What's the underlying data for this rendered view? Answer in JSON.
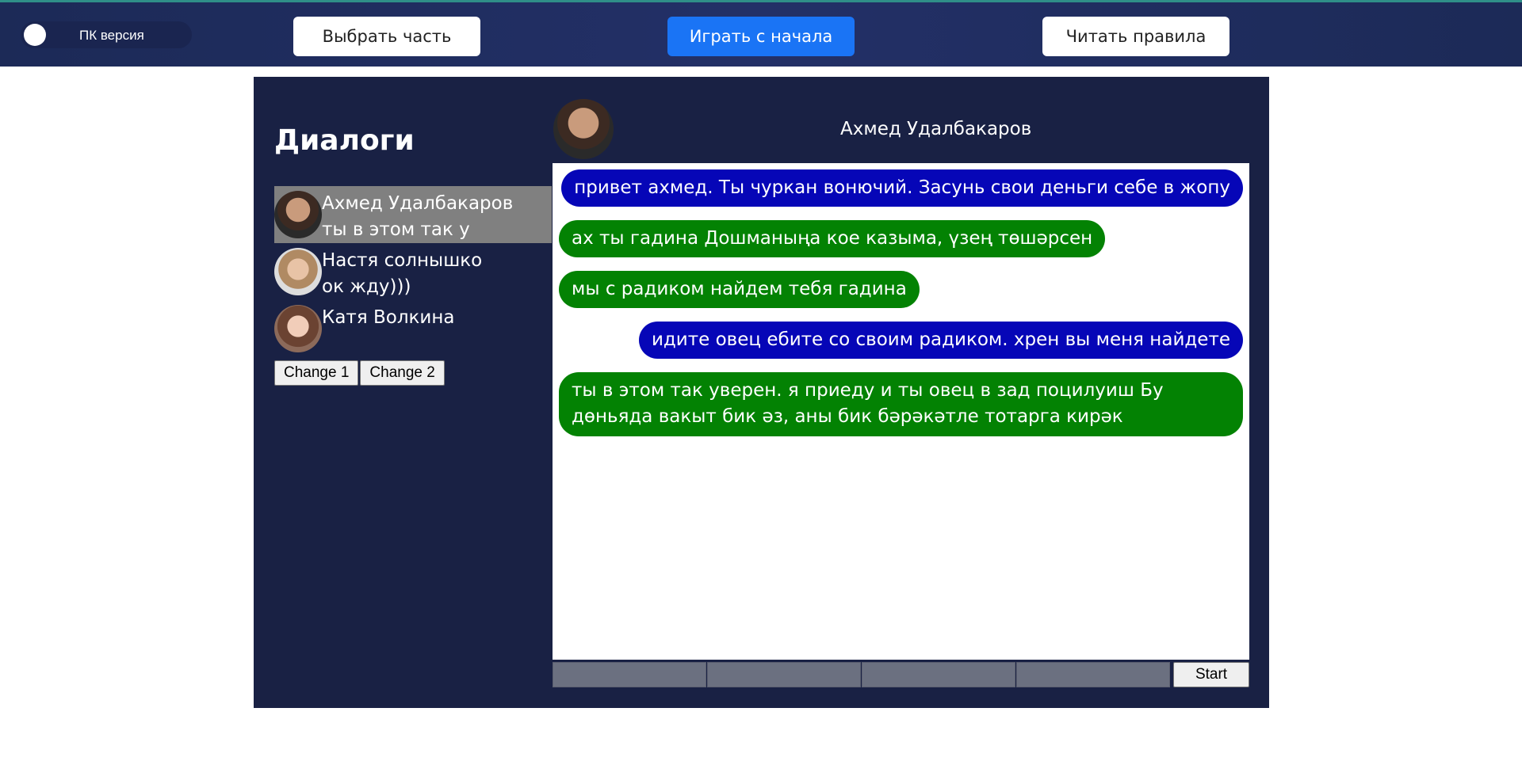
{
  "header": {
    "toggle_label": "ПК версия",
    "choose_part_label": "Выбрать часть",
    "restart_label": "Играть с начала",
    "rules_label": "Читать правила"
  },
  "sidebar": {
    "title": "Диалоги",
    "dialogs": [
      {
        "name": "Ахмед Удалбакаров",
        "preview": "ты в этом так у",
        "active": true
      },
      {
        "name": "Настя солнышко",
        "preview": "ок жду)))",
        "active": false
      },
      {
        "name": "Катя Волкина",
        "preview": "",
        "active": false
      }
    ],
    "change1_label": "Change 1",
    "change2_label": "Change 2"
  },
  "chat": {
    "contact_name": "Ахмед Удалбакаров",
    "messages": [
      {
        "direction": "out",
        "text": "привет ахмед. Ты чуркан вонючий. Засунь свои деньги себе в жопу"
      },
      {
        "direction": "in",
        "text": "ах ты гадина Дошманыңа кое казыма, үзең төшәрсен"
      },
      {
        "direction": "in",
        "text": "мы с радиком найдем тебя гадина"
      },
      {
        "direction": "out",
        "text": "идите овец ебите со своим радиком. хрен вы меня найдете"
      },
      {
        "direction": "in",
        "text": "ты в этом так уверен. я приеду и ты овец в зад поцилуиш Бу дөньяда вакыт бик әз, аны бик бәрәкәтле тотарга кирәк"
      }
    ],
    "start_label": "Start"
  },
  "colors": {
    "outgoing_bubble": "#0606b7",
    "incoming_bubble": "#038203",
    "game_bg": "#192144",
    "accent_button": "#1a74f5"
  }
}
